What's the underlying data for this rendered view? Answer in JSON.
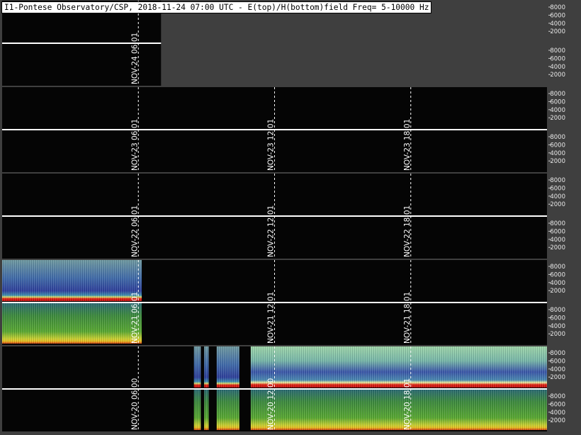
{
  "title": "I1-Pontese Observatory/CSP, 2018-11-24 07:00 UTC - E(top)/H(bottom)field Freq= 5-10000 Hz",
  "chart_data": {
    "type": "heatmap",
    "description_fields": [
      "rows are days, each with E-field (top) and H-field (bottom) spectrograms"
    ],
    "x_range_hours_utc": [
      0,
      24
    ],
    "y_range_hz": [
      5,
      10000
    ],
    "y_ticks": [
      "8000",
      "6000",
      "4000",
      "2000"
    ],
    "rows": [
      {
        "day": "NOV-24",
        "data_until_hour": 7.0,
        "time_markers": [
          {
            "label": "06:01",
            "hour": 6.0
          }
        ],
        "segments": []
      },
      {
        "day": "NOV-23",
        "data_until_hour": 24,
        "time_markers": [
          {
            "label": "06:01",
            "hour": 6.0
          },
          {
            "label": "12:01",
            "hour": 12.0
          },
          {
            "label": "18:01",
            "hour": 18.0
          }
        ],
        "segments": []
      },
      {
        "day": "NOV-22",
        "data_until_hour": 24,
        "time_markers": [
          {
            "label": "06:01",
            "hour": 6.0
          },
          {
            "label": "12:01",
            "hour": 12.0
          },
          {
            "label": "18:01",
            "hour": 18.0
          }
        ],
        "segments": []
      },
      {
        "day": "NOV-21",
        "data_until_hour": 24,
        "time_markers": [
          {
            "label": "06:01",
            "hour": 6.0
          },
          {
            "label": "12:01",
            "hour": 12.0
          },
          {
            "label": "18:01",
            "hour": 18.0
          }
        ],
        "segments": [
          {
            "start_hour": 0.0,
            "end_hour": 6.15
          }
        ]
      },
      {
        "day": "NOV-20",
        "data_until_hour": 24,
        "time_markers": [
          {
            "label": "06:00",
            "hour": 6.0
          },
          {
            "label": "12:00",
            "hour": 12.0
          },
          {
            "label": "18:01",
            "hour": 18.0
          }
        ],
        "segments": [
          {
            "start_hour": 8.45,
            "end_hour": 8.75
          },
          {
            "start_hour": 8.9,
            "end_hour": 9.1
          },
          {
            "start_hour": 9.45,
            "end_hour": 10.45
          },
          {
            "start_hour": 10.95,
            "end_hour": 24.0
          }
        ]
      }
    ]
  }
}
